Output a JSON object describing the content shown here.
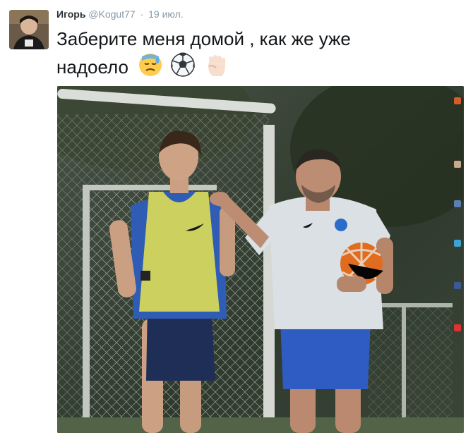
{
  "tweet": {
    "author_name": "Игорь",
    "author_handle": "@Kogut77",
    "separator": "·",
    "date": "19 июл.",
    "text": "Заберите меня домой , как же уже надоело"
  },
  "icons": {
    "emoji": [
      "disappointed-relieved-face-icon",
      "soccer-ball-icon",
      "raised-fist-icon"
    ],
    "avatar": "avatar"
  },
  "colors": {
    "name": "#292f33",
    "muted": "#8899a6",
    "text": "#14171a"
  }
}
